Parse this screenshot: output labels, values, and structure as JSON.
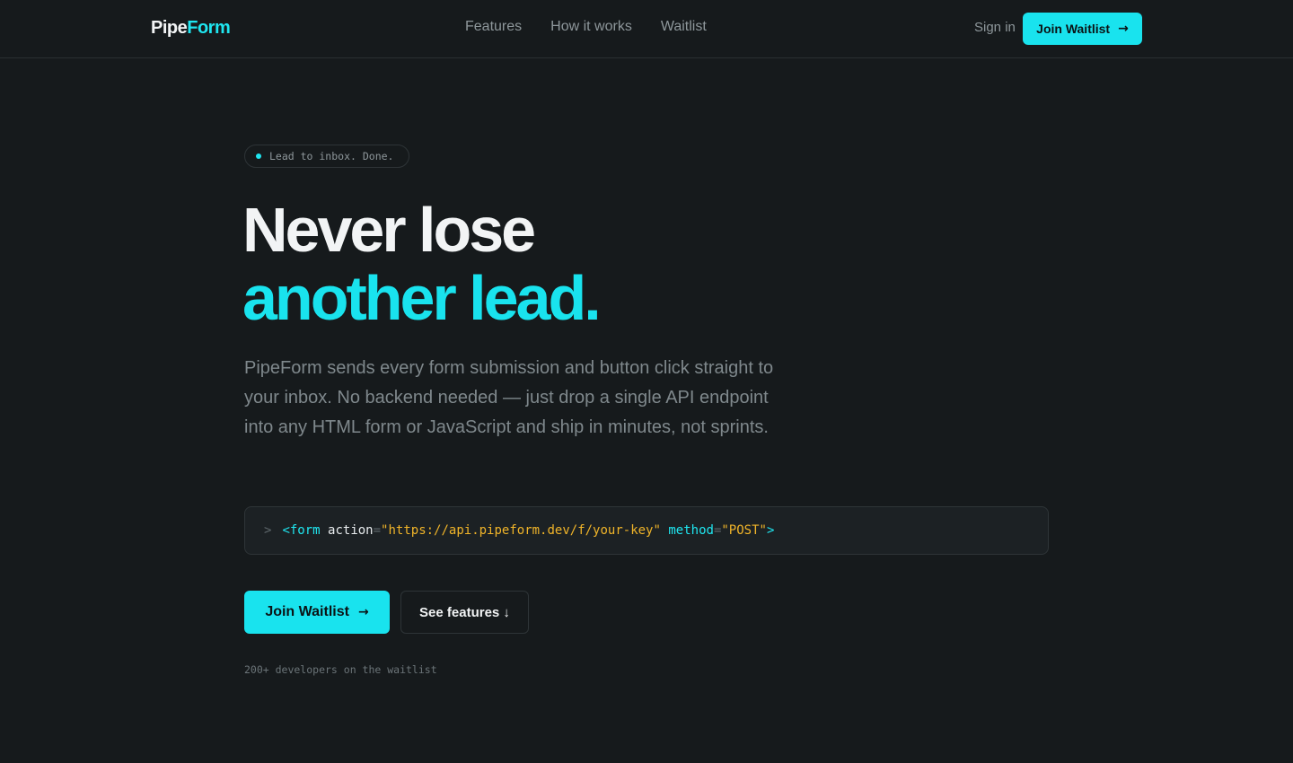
{
  "nav": {
    "brand_part1": "Pipe",
    "brand_part2": "Form",
    "links": [
      "Features",
      "How it works",
      "Waitlist"
    ],
    "signin_label": "Sign in",
    "cta_label": "Join Waitlist",
    "cta_icon": "arrow-right-icon"
  },
  "hero": {
    "badge_text": "Lead to inbox. Done.",
    "headline_line1": "Never lose",
    "headline_line2": "another lead.",
    "lede": "PipeForm sends every form submission and button click straight to your inbox. No backend needed — just drop a single API endpoint into any HTML form or JavaScript and ship in minutes, not sprints.",
    "code": {
      "prompt": ">",
      "tag_open": "<form",
      "attr_action": "action",
      "eq": "=",
      "action_value": "\"https://api.pipeform.dev/f/your-key\"",
      "attr_method": "method",
      "method_value": "\"POST\"",
      "tag_close": ">"
    },
    "primary_button": "Join Waitlist",
    "secondary_button": "See features ↓",
    "footnote": "200+ developers on the waitlist"
  },
  "colors": {
    "background": "#161a1c",
    "accent": "#19e3ee",
    "muted_text": "#7f888c",
    "string_color": "#f0b429"
  }
}
